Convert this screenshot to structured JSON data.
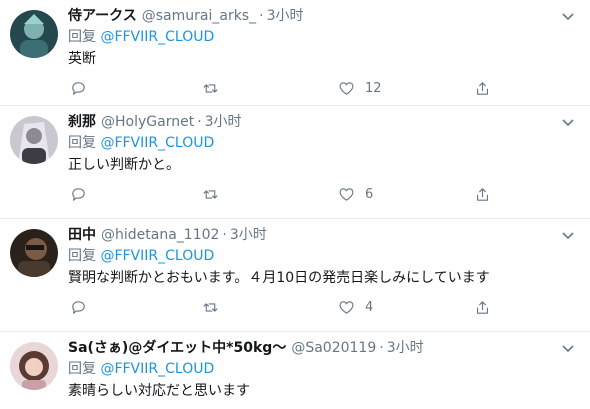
{
  "reply_prefix": "回复",
  "tweets": [
    {
      "name": "侍アークス",
      "handle": "@samurai_arks_",
      "time": "3小时",
      "reply_to": "@FFVIIR_CLOUD",
      "text": "英断",
      "likes": "12",
      "avatar_color": "#3a6b6e"
    },
    {
      "name": "刹那",
      "handle": "@HolyGarnet",
      "time": "3小时",
      "reply_to": "@FFVIIR_CLOUD",
      "text": "正しい判断かと。",
      "likes": "6",
      "avatar_color": "#6b6a73"
    },
    {
      "name": "田中",
      "handle": "@hidetana_1102",
      "time": "3小时",
      "reply_to": "@FFVIIR_CLOUD",
      "text": "賢明な判断かとおもいます。４月10日の発売日楽しみにしています",
      "likes": "4",
      "avatar_color": "#4a3a2e"
    },
    {
      "name": "Sa(さぁ)@ダイエット中*50kg～",
      "handle": "@Sa020119",
      "time": "3小时",
      "reply_to": "@FFVIIR_CLOUD",
      "text": "素晴らしい対応だと思います",
      "likes": "",
      "avatar_color": "#b07a80"
    }
  ],
  "colors": {
    "link": "#1b95e0",
    "secondary_text": "#657786",
    "divider": "#e6ecf0"
  },
  "icons": [
    "reply-icon",
    "retweet-icon",
    "like-icon",
    "share-icon",
    "caret-down-icon"
  ]
}
